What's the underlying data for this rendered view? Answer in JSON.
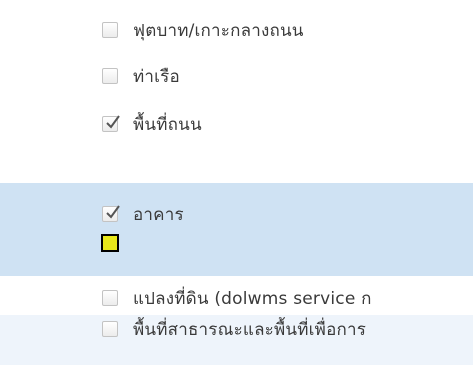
{
  "layers": [
    {
      "label": "ฟุตบาท/เกาะกลางถนน",
      "checked": false
    },
    {
      "label": "ท่าเรือ",
      "checked": false
    },
    {
      "label": "พื้นที่ถนน",
      "checked": true
    },
    {
      "label": "อาคาร",
      "checked": true,
      "selected": true,
      "legend_color": "#e8e81a"
    },
    {
      "label": "แปลงที่ดิน (dolwms service ก",
      "checked": false
    },
    {
      "label": "พื้นที่สาธารณะและพื้นที่เพื่อการ",
      "checked": false
    }
  ],
  "colors": {
    "selected_row": "#cfe2f3",
    "alt_row": "#eef4fb",
    "legend_swatch": "#e8e81a"
  },
  "icons": {
    "checked": "checkmark-icon",
    "unchecked": "empty-checkbox-icon"
  }
}
